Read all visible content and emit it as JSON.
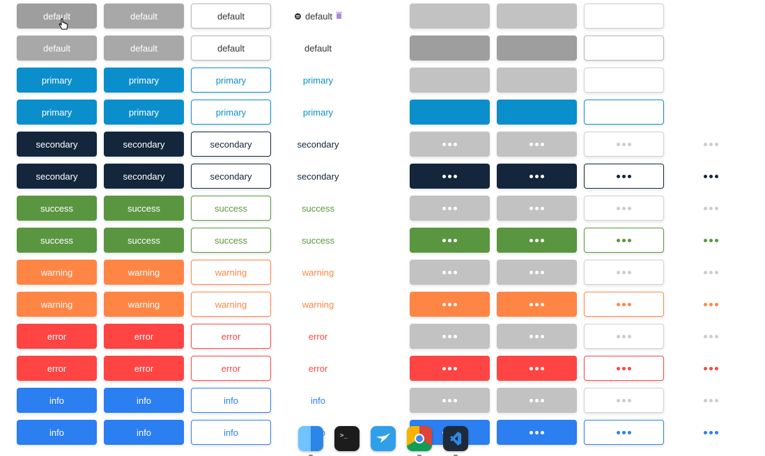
{
  "theme": {
    "default_strong": "#9e9e9e",
    "default": "#a8a8a8",
    "default_text": "#333333",
    "disabled": "#c2c2c2",
    "disabled_text": "#cccccc",
    "primary": "#0b8fcc",
    "secondary": "#13263c",
    "success": "#5a9640",
    "warning": "#ff8545",
    "error": "#ff4444",
    "info": "#2b7ff0"
  },
  "hovered_row_label": "default",
  "rows": [
    {
      "label": "default",
      "kind": "default",
      "icon": true,
      "col5": "plain",
      "col8": "none"
    },
    {
      "label": "default",
      "kind": "default",
      "icon": false,
      "col5": "solid",
      "col8": "none"
    },
    {
      "label": "primary",
      "kind": "primary",
      "icon": false,
      "col5": "plain",
      "col8": "none"
    },
    {
      "label": "primary",
      "kind": "primary",
      "icon": false,
      "col5": "solid",
      "col8": "none"
    },
    {
      "label": "secondary",
      "kind": "secondary",
      "icon": false,
      "col5": "disabled-dots",
      "col8": "disabled-dots"
    },
    {
      "label": "secondary",
      "kind": "secondary",
      "icon": false,
      "col5": "dots",
      "col8": "dots"
    },
    {
      "label": "success",
      "kind": "success",
      "icon": false,
      "col5": "disabled-dots",
      "col8": "disabled-dots"
    },
    {
      "label": "success",
      "kind": "success",
      "icon": false,
      "col5": "dots",
      "col8": "dots"
    },
    {
      "label": "warning",
      "kind": "warning",
      "icon": false,
      "col5": "disabled-dots",
      "col8": "disabled-dots"
    },
    {
      "label": "warning",
      "kind": "warning",
      "icon": false,
      "col5": "dots",
      "col8": "dots"
    },
    {
      "label": "error",
      "kind": "error",
      "icon": false,
      "col5": "disabled-dots",
      "col8": "disabled-dots"
    },
    {
      "label": "error",
      "kind": "error",
      "icon": false,
      "col5": "dots",
      "col8": "dots"
    },
    {
      "label": "info",
      "kind": "info",
      "icon": false,
      "col5": "disabled-dots",
      "col8": "disabled-dots"
    },
    {
      "label": "info",
      "kind": "info",
      "icon": false,
      "col5": "dots",
      "col8": "dots"
    }
  ],
  "dock": [
    {
      "name": "finder-icon",
      "color": "#3aa0f0"
    },
    {
      "name": "terminal-icon",
      "color": "#1c1c1c"
    },
    {
      "name": "migration-assistant-icon",
      "color": "#2fa0e8"
    },
    {
      "name": "chrome-icon",
      "color": "#ffffff"
    },
    {
      "name": "vscode-icon",
      "color": "#1e2a3a"
    }
  ]
}
